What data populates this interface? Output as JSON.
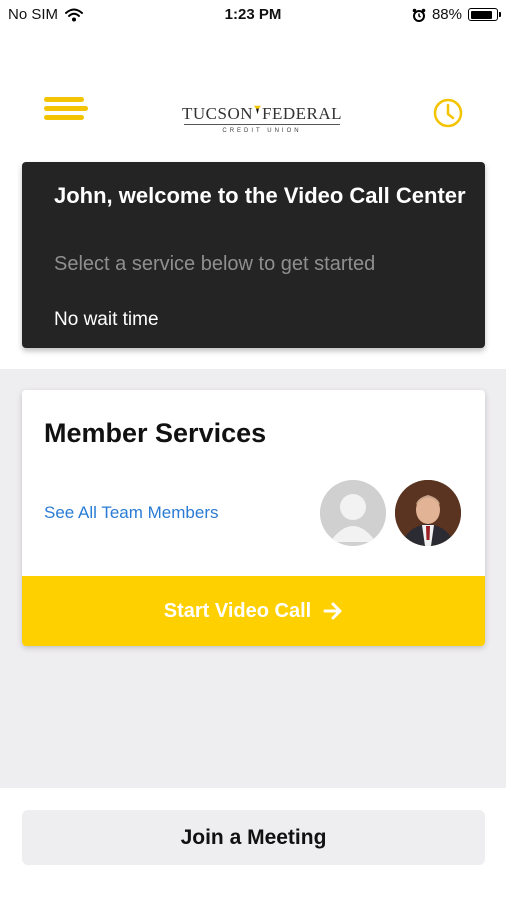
{
  "status_bar": {
    "carrier": "No SIM",
    "time": "1:23 PM",
    "battery": "88%",
    "battery_level": 0.88
  },
  "header": {
    "logo": {
      "left_word": "TUCSON",
      "right_word": "FEDERAL",
      "tagline": "CREDIT UNION"
    },
    "menu_icon": "hamburger-icon",
    "history_icon": "clock-icon"
  },
  "welcome": {
    "title": "John, welcome to the Video Call Center",
    "subtitle": "Select a service below to get started",
    "wait_time": "No wait time"
  },
  "service": {
    "title": "Member Services",
    "team_link": "See All Team Members",
    "start_button": "Start Video Call",
    "start_icon": "arrow-right-icon"
  },
  "join": {
    "label": "Join a Meeting"
  },
  "colors": {
    "accent": "#FFD000",
    "card_dark": "#242424",
    "link": "#2a7bd5",
    "background_grey": "#eeedef"
  }
}
